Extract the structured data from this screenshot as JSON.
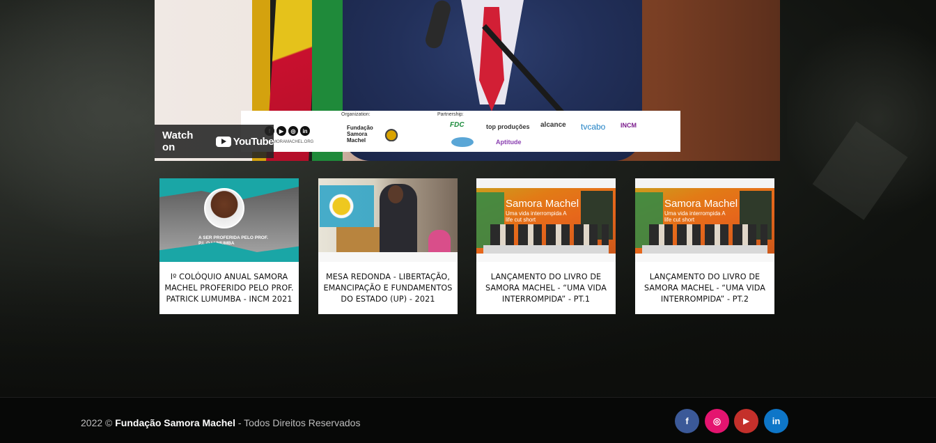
{
  "video": {
    "watch_label": "Watch on",
    "youtube_label": "YouTube",
    "banner": {
      "social_icons": [
        "f",
        "▶",
        "◎",
        "in"
      ],
      "site": "SAMORAMACHEL.ORG",
      "organization_label": "Organization:",
      "organization_name": "Fundação Samora Machel",
      "partnership_label": "Partnership:",
      "partners": [
        "FDC",
        "top produções",
        "alcance",
        "tvcabo",
        "INCM",
        "Aptitude"
      ]
    }
  },
  "cards": [
    {
      "title": "Iº Colóquio Anual Samora Machel proferido pelo Prof. Patrick Lumumba - INCM 2021",
      "thumb_text": "A SER PROFERIDA PELO PROF. P.L.O LUMUMBA"
    },
    {
      "title": "Mesa Redonda - Libertação, Emancipação e Fundamentos do Estado (UP) - 2021",
      "thumb_text": ""
    },
    {
      "title": "Lançamento do livro de Samora Machel - “Uma vida interrompida” - Pt.1",
      "thumb_title": "Samora Machel",
      "thumb_sub": "Uma vida interrompida A life cut short"
    },
    {
      "title": "Lançamento do livro de Samora Machel - “Uma vida interrompida” - Pt.2",
      "thumb_title": "Samora Machel",
      "thumb_sub": "Uma vida interrompida A life cut short"
    }
  ],
  "footer": {
    "year": "2022 ©",
    "brand": "Fundação Samora Machel",
    "rights": "- Todos Direitos Reservados",
    "social": [
      {
        "name": "facebook",
        "glyph": "f",
        "color": "#3b5998"
      },
      {
        "name": "instagram",
        "glyph": "◎",
        "color": "#e4146f"
      },
      {
        "name": "youtube",
        "glyph": "▶",
        "color": "#c4302b"
      },
      {
        "name": "linkedin",
        "glyph": "in",
        "color": "#0e76c8"
      }
    ]
  }
}
